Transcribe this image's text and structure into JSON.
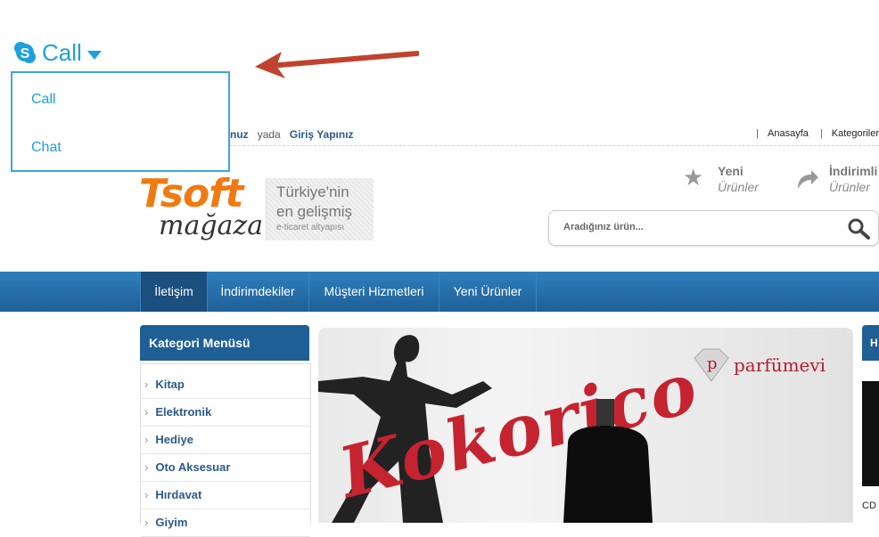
{
  "skype": {
    "label": "Call",
    "menu": [
      "Call",
      "Chat"
    ]
  },
  "header": {
    "login_partial": "nuz",
    "login_or": "yada",
    "login_link": "Giriş Yapınız",
    "top_links": [
      "Anasayfa",
      "Kategoriler"
    ],
    "logo_main": "Tsoft",
    "logo_sub": "mağaza",
    "tagline_1": "Türkiye'nin",
    "tagline_2": "en gelişmiş",
    "tagline_3": "e-ticaret altyapısı",
    "quick_links": [
      {
        "title": "Yeni",
        "sub": "Ürünler",
        "icon": "star-icon"
      },
      {
        "title": "İndirimli",
        "sub": "Ürünler",
        "icon": "curved-arrow-icon"
      }
    ],
    "search_placeholder": "Aradığınız ürün..."
  },
  "nav": {
    "items": [
      "İletişim",
      "İndirimdekiler",
      "Müşteri Hizmetleri",
      "Yeni Ürünler"
    ],
    "active": "İletişim"
  },
  "categories": {
    "title": "Kategori Menüsü",
    "items": [
      "Kitap",
      "Elektronik",
      "Hediye",
      "Oto Aksesuar",
      "Hırdavat",
      "Giyim"
    ]
  },
  "banner": {
    "brand": "parfümevi",
    "product": "Kokorico"
  },
  "right_panel": {
    "title_partial": "H",
    "bottom_text": "CD"
  },
  "colors": {
    "accent_blue": "#1ea0de",
    "nav_blue": "#1f5f96",
    "logo_orange": "#f07a11",
    "arrow_red": "#c0432f"
  }
}
